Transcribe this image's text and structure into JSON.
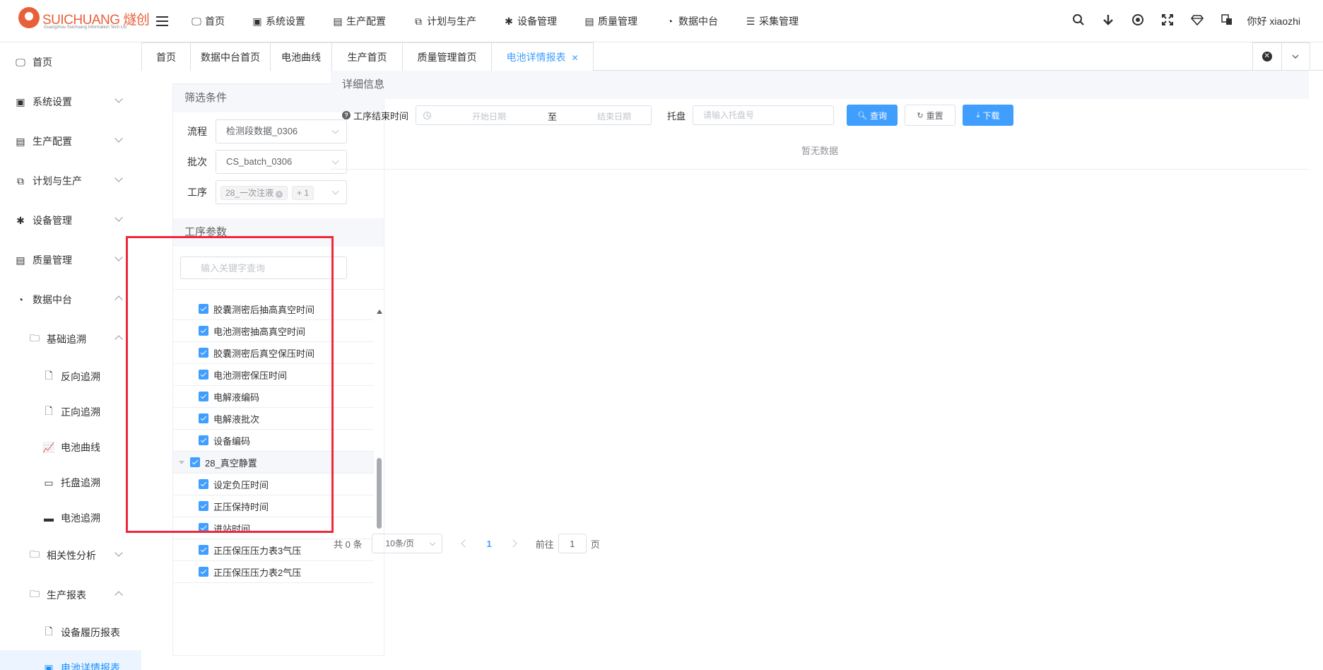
{
  "brand": {
    "name": "SUICHUANG 燧创",
    "subtitle": "Guangzhou Suichuang Information Tech Ltd"
  },
  "topnav": [
    {
      "label": "首页",
      "icon": "monitor-icon"
    },
    {
      "label": "系统设置",
      "icon": "user-card-icon"
    },
    {
      "label": "生产配置",
      "icon": "briefcase-icon"
    },
    {
      "label": "计划与生产",
      "icon": "windows-icon"
    },
    {
      "label": "设备管理",
      "icon": "gear-icon"
    },
    {
      "label": "质量管理",
      "icon": "briefcase-icon"
    },
    {
      "label": "数据中台",
      "icon": "pie-chart-icon"
    },
    {
      "label": "采集管理",
      "icon": "database-icon"
    }
  ],
  "header": {
    "greeting": "你好 xiaozhi"
  },
  "sidebar": {
    "items": [
      {
        "label": "首页",
        "icon": "monitor-icon",
        "chevron": "",
        "indent": 0
      },
      {
        "label": "系统设置",
        "icon": "user-card-icon",
        "chevron": "down",
        "indent": 0
      },
      {
        "label": "生产配置",
        "icon": "briefcase-icon",
        "chevron": "down",
        "indent": 0
      },
      {
        "label": "计划与生产",
        "icon": "windows-icon",
        "chevron": "down",
        "indent": 0
      },
      {
        "label": "设备管理",
        "icon": "gear-icon",
        "chevron": "down",
        "indent": 0
      },
      {
        "label": "质量管理",
        "icon": "briefcase-icon",
        "chevron": "down",
        "indent": 0
      },
      {
        "label": "数据中台",
        "icon": "pie-chart-icon",
        "chevron": "up",
        "indent": 0
      },
      {
        "label": "基础追溯",
        "icon": "folder-icon",
        "chevron": "up",
        "indent": 1
      },
      {
        "label": "反向追溯",
        "icon": "document-icon",
        "chevron": "",
        "indent": 2
      },
      {
        "label": "正向追溯",
        "icon": "document-icon",
        "chevron": "",
        "indent": 2
      },
      {
        "label": "电池曲线",
        "icon": "line-chart-icon",
        "chevron": "",
        "indent": 2
      },
      {
        "label": "托盘追溯",
        "icon": "tray-icon",
        "chevron": "",
        "indent": 2
      },
      {
        "label": "电池追溯",
        "icon": "battery-icon",
        "chevron": "",
        "indent": 2
      },
      {
        "label": "相关性分析",
        "icon": "folder-icon",
        "chevron": "down",
        "indent": 1
      },
      {
        "label": "生产报表",
        "icon": "folder-icon",
        "chevron": "up",
        "indent": 1
      },
      {
        "label": "设备履历报表",
        "icon": "document-icon",
        "chevron": "",
        "indent": 2
      },
      {
        "label": "电池详情报表",
        "icon": "report-icon",
        "chevron": "",
        "indent": 2
      }
    ]
  },
  "tabs": [
    {
      "label": "首页"
    },
    {
      "label": "数据中台首页"
    },
    {
      "label": "电池曲线"
    },
    {
      "label": "生产首页"
    },
    {
      "label": "质量管理首页"
    },
    {
      "label": "电池详情报表",
      "active": true
    }
  ],
  "filter": {
    "title": "筛选条件",
    "flow_label": "流程",
    "flow_value": "检测段数据_0306",
    "batch_label": "批次",
    "batch_value": "CS_batch_0306",
    "process_label": "工序",
    "process_tag": "28_一次注液",
    "process_more": "+ 1"
  },
  "params": {
    "title": "工序参数",
    "search_placeholder": "输入关键字查询",
    "rows": [
      {
        "label": "胶囊测密后抽高真空时间",
        "level": 1
      },
      {
        "label": "电池测密抽高真空时间",
        "level": 1
      },
      {
        "label": "胶囊测密后真空保压时间",
        "level": 1
      },
      {
        "label": "电池测密保压时间",
        "level": 1
      },
      {
        "label": "电解液编码",
        "level": 1
      },
      {
        "label": "电解液批次",
        "level": 1
      },
      {
        "label": "设备编码",
        "level": 1
      },
      {
        "label": "28_真空静置",
        "level": 0
      },
      {
        "label": "设定负压时间",
        "level": 1
      },
      {
        "label": "正压保持时间",
        "level": 1
      },
      {
        "label": "进站时间",
        "level": 1
      },
      {
        "label": "正压保压压力表3气压",
        "level": 1
      },
      {
        "label": "正压保压压力表2气压",
        "level": 1
      }
    ]
  },
  "detail": {
    "title": "详细信息",
    "time_label": "工序结束时间",
    "start_placeholder": "开始日期",
    "range_sep": "至",
    "end_placeholder": "结束日期",
    "pallet_label": "托盘",
    "pallet_placeholder": "请输入托盘号",
    "query_label": "查询",
    "reset_label": "重置",
    "download_label": "下载",
    "empty_text": "暂无数据"
  },
  "pager": {
    "total": "共 0 条",
    "page_size": "10条/页",
    "current": "1",
    "goto_label": "前往",
    "goto_value": "1",
    "page_unit": "页"
  },
  "colors": {
    "primary": "#409eff",
    "highlight": "#f0283c",
    "brand": "#e8603a"
  }
}
